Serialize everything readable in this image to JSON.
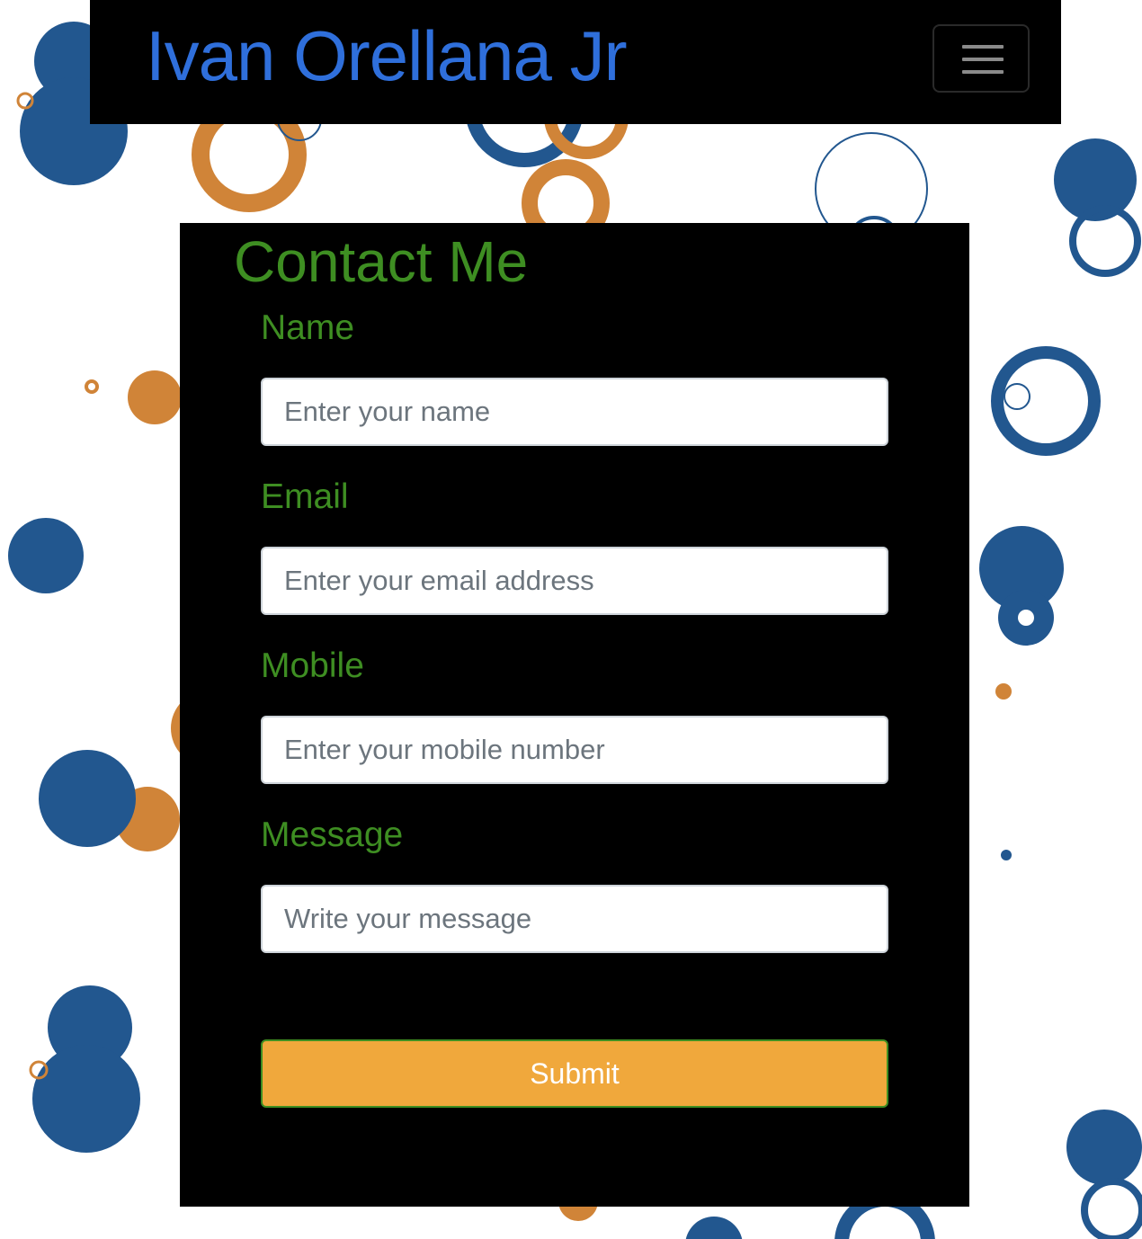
{
  "navbar": {
    "brand": "Ivan Orellana Jr",
    "menu_icon": "hamburger-menu-icon"
  },
  "contact_form": {
    "title": "Contact Me",
    "fields": [
      {
        "label": "Name",
        "placeholder": "Enter your name"
      },
      {
        "label": "Email",
        "placeholder": "Enter your email address"
      },
      {
        "label": "Mobile",
        "placeholder": "Enter your mobile number"
      },
      {
        "label": "Message",
        "placeholder": "Write your message"
      }
    ],
    "submit_label": "Submit"
  },
  "colors": {
    "brand_text": "#2f6fdb",
    "heading_green": "#3e8e22",
    "submit_bg": "#f0a83c",
    "panel_bg": "#000000",
    "bubble_blue": "#22578f",
    "bubble_orange": "#d08438"
  }
}
